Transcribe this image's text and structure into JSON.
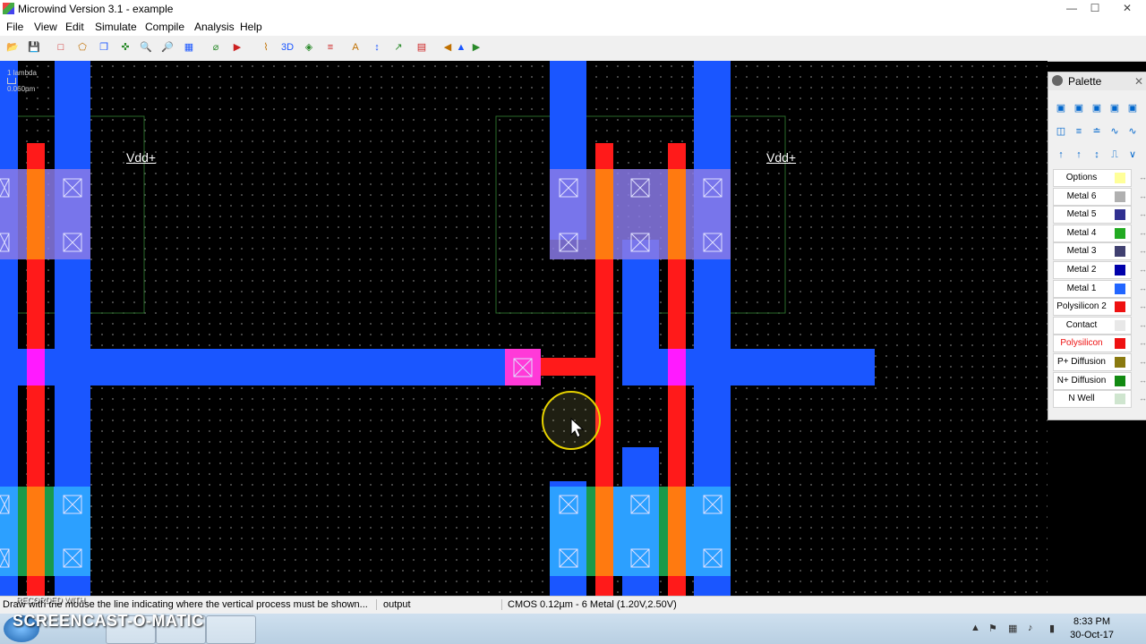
{
  "window": {
    "title": "Microwind Version 3.1 - example",
    "minimize": "—",
    "maximize": "☐",
    "close": "✕"
  },
  "menu": [
    "File",
    "View",
    "Edit",
    "Simulate",
    "Compile",
    "Analysis",
    "Help"
  ],
  "toolbar": {
    "icons": [
      "open-icon",
      "save-icon",
      "draw-box-icon",
      "draw-poly-icon",
      "copy-icon",
      "move-icon",
      "zoom-in-icon",
      "zoom-out-icon",
      "fit-icon",
      "connect-icon",
      "run-simulation-icon",
      "cross-section-icon",
      "process-3d-icon",
      "view-3d-icon",
      "navigator-icon",
      "text-icon",
      "measure-icon",
      "graph-icon",
      "layers-icon",
      "arrow-left-icon",
      "arrow-up-down-icon",
      "arrow-right-icon"
    ],
    "glyphs": [
      "📂",
      "💾",
      "□",
      "⬠",
      "❐",
      "✜",
      "🔍",
      "🔎",
      "▦",
      "⌀",
      "▶",
      "⌇",
      "3D",
      "◈",
      "≡",
      "A",
      "↕",
      "↗",
      "▤",
      "◀",
      "▲",
      "▶"
    ]
  },
  "canvas": {
    "scale_label": "1 lambda",
    "scale_value": "0.060µm",
    "vdd_labels": [
      "Vdd+",
      "Vdd+"
    ]
  },
  "palette": {
    "title": "Palette",
    "close": "✕",
    "icons": [
      "▣",
      "▣",
      "▣",
      "▣",
      "▣",
      "◫",
      "≡",
      "≐",
      "∿",
      "∿",
      "↑",
      "↑",
      "↕",
      "⎍",
      "∨",
      "◎"
    ],
    "layers": [
      {
        "name": "Options",
        "color": "#ffff99"
      },
      {
        "name": "Metal 6",
        "color": "#b0b0b0"
      },
      {
        "name": "Metal 5",
        "color": "#303090"
      },
      {
        "name": "Metal 4",
        "color": "#22aa22"
      },
      {
        "name": "Metal 3",
        "color": "#404070"
      },
      {
        "name": "Metal 2",
        "color": "#0000aa"
      },
      {
        "name": "Metal 1",
        "color": "#2266ff"
      },
      {
        "name": "Polysilicon 2",
        "color": "#ee1111"
      },
      {
        "name": "Contact",
        "color": "#e8e8e8"
      },
      {
        "name": "Polysilicon",
        "color": "#ee1111"
      },
      {
        "name": "P+ Diffusion",
        "color": "#8a7a10"
      },
      {
        "name": "N+ Diffusion",
        "color": "#128a12"
      },
      {
        "name": "N Well",
        "color": "#cfe5cf"
      }
    ],
    "selected_index": 9
  },
  "status": {
    "hint": "Draw with the mouse the line indicating where the vertical process must be shown...",
    "panel": "output",
    "tech": "CMOS 0.12µm - 6 Metal (1.20V,2.50V)"
  },
  "taskbar": {
    "time": "8:33 PM",
    "date": "30-Oct-17",
    "watermark": "SCREENCAST-O-MATIC",
    "watermark_small": "RECORDED WITH"
  }
}
